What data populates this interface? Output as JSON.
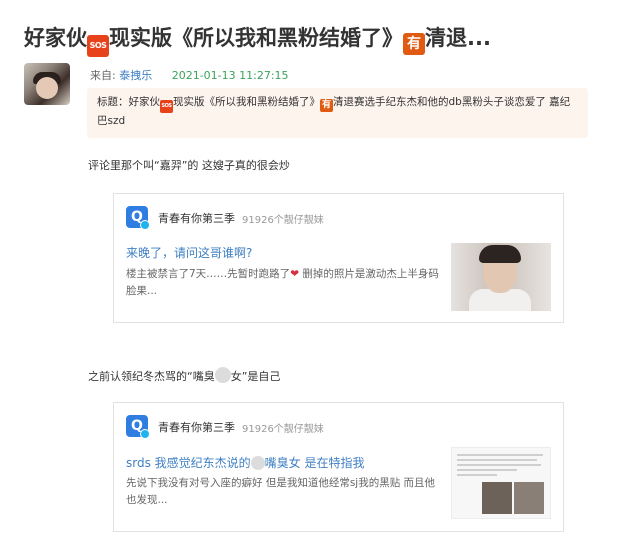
{
  "post": {
    "title_part1": "好家伙",
    "title_badge1": "SOS",
    "title_part2": "现实版《所以我和黑粉结婚了》",
    "title_badge2": "有",
    "title_part3": "清退...",
    "source_label": "来自:",
    "author": "泰拽乐",
    "timestamp": "2021-01-13 11:27:15",
    "subject_part1": "标题：好家伙",
    "subject_badge1": "SOS",
    "subject_part2": "现实版《所以我和黑粉结婚了》",
    "subject_badge2": "有",
    "subject_part3": "清退赛选手纪东杰和他的db黑粉头子谈恋爱了 嘉纪巴szd"
  },
  "body": {
    "paragraph1": "评论里那个叫“嘉羿”的 这嫂子真的很会炒",
    "paragraph2_part1": "之前认领纪冬杰骂的“嘴臭",
    "paragraph2_part2": "女”是自己"
  },
  "cards": [
    {
      "community": "青春有你第三季",
      "fans": "91926个靓仔靓妹",
      "question": "来晚了，请问这哥谁啊?",
      "answer_part1": "楼主被禁言了7天……先暂时跑路了",
      "answer_part2": " 删掉的照片是激动杰上半身码脸果..."
    },
    {
      "community": "青春有你第三季",
      "fans": "91926个靓仔靓妹",
      "question_part1": "srds 我感觉纪东杰说的",
      "question_part2": "嘴臭女 是在特指我",
      "answer": "先说下我没有对号入座的癖好 但是我知道他经常sj我的黑贴 而且他也发现..."
    }
  ],
  "colors": {
    "link_blue": "#3f7fc4",
    "time_green": "#3aa35b",
    "badge_red": "#e8421b",
    "badge_orange": "#e05a12",
    "subject_bg": "#fdf4ee"
  },
  "icons": [
    "sos-badge-icon",
    "you-badge-icon",
    "heart-icon",
    "community-logo-icon"
  ]
}
